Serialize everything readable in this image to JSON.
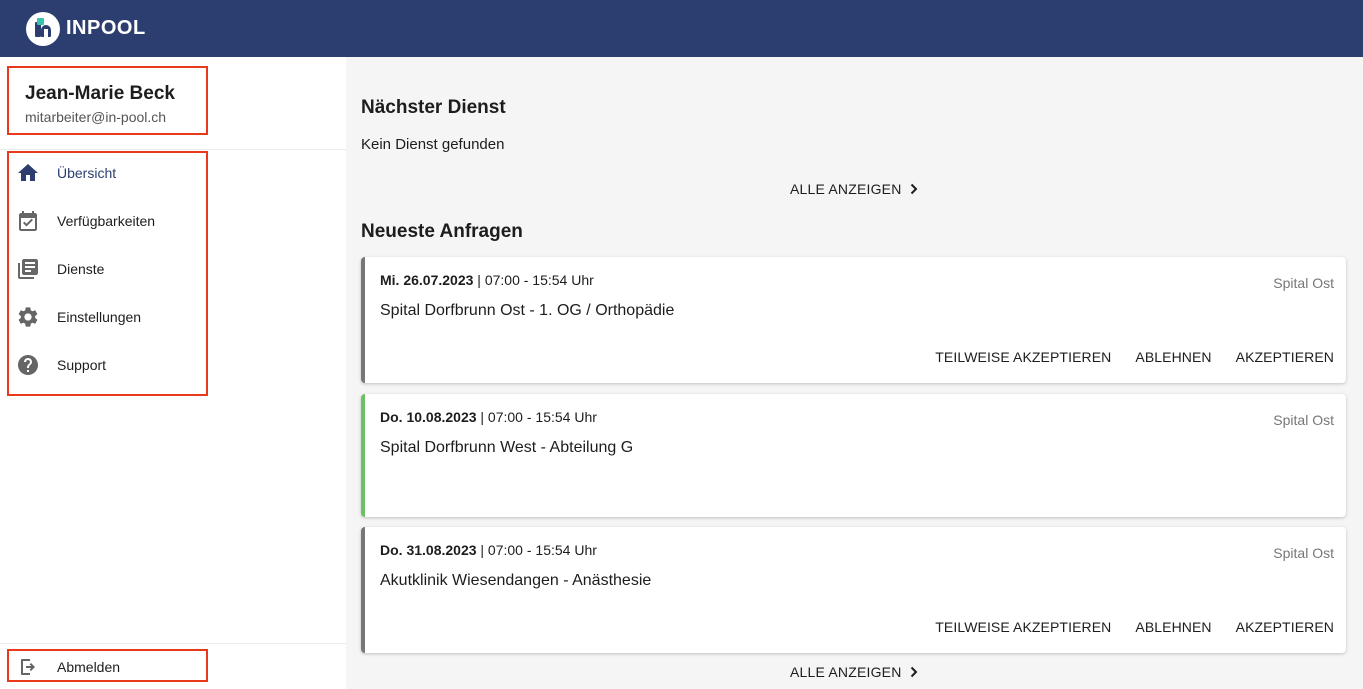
{
  "app": {
    "brand": "INPOOL"
  },
  "user": {
    "name": "Jean-Marie Beck",
    "email": "mitarbeiter@in-pool.ch"
  },
  "nav": {
    "items": [
      {
        "label": "Übersicht",
        "icon": "home-icon",
        "active": true
      },
      {
        "label": "Verfügbarkeiten",
        "icon": "calendar-check-icon",
        "active": false
      },
      {
        "label": "Dienste",
        "icon": "library-books-icon",
        "active": false
      },
      {
        "label": "Einstellungen",
        "icon": "gear-icon",
        "active": false
      },
      {
        "label": "Support",
        "icon": "help-circle-icon",
        "active": false
      }
    ],
    "logout": {
      "label": "Abmelden",
      "icon": "logout-icon"
    }
  },
  "next_shift": {
    "title": "Nächster Dienst",
    "empty_text": "Kein Dienst gefunden",
    "show_all": "ALLE ANZEIGEN"
  },
  "requests": {
    "title": "Neueste Anfragen",
    "show_all": "ALLE ANZEIGEN",
    "items": [
      {
        "date": "Mi. 26.07.2023",
        "time": " | 07:00 - 15:54 Uhr",
        "organization": "Spital Ost",
        "location": "Spital Dorfbrunn Ost - 1. OG / Orthopädie",
        "status_color": "#777777",
        "actions": {
          "partial": "TEILWEISE AKZEPTIEREN",
          "decline": "ABLEHNEN",
          "accept": "AKZEPTIEREN"
        }
      },
      {
        "date": "Do. 10.08.2023",
        "time": " | 07:00 - 15:54 Uhr",
        "organization": "Spital Ost",
        "location": "Spital Dorfbrunn West - Abteilung G",
        "status_color": "#6cc164"
      },
      {
        "date": "Do. 31.08.2023",
        "time": " | 07:00 - 15:54 Uhr",
        "organization": "Spital Ost",
        "location": "Akutklinik Wiesendangen - Anästhesie",
        "status_color": "#777777",
        "actions": {
          "partial": "TEILWEISE AKZEPTIEREN",
          "decline": "ABLEHNEN",
          "accept": "AKZEPTIEREN"
        }
      }
    ]
  },
  "colors": {
    "header": "#2c3e70",
    "highlight_border": "#e8391b",
    "accent_green": "#6cc164"
  }
}
